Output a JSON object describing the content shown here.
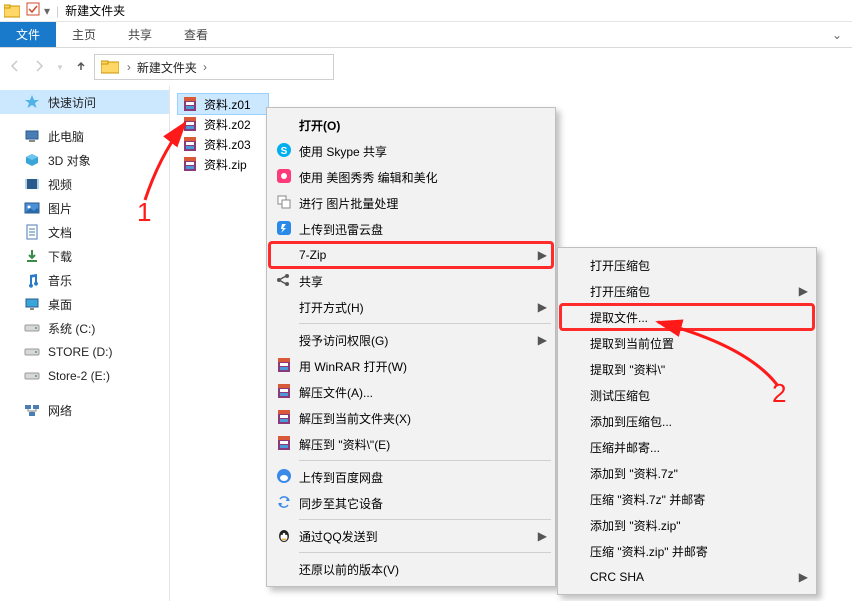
{
  "titlebar": {
    "title": "新建文件夹"
  },
  "ribbon": {
    "tabs": [
      "文件",
      "主页",
      "共享",
      "查看"
    ],
    "active_index": 0
  },
  "breadcrumb": {
    "items": [
      "",
      "新建文件夹"
    ]
  },
  "sidebar": {
    "items": [
      {
        "label": "快速访问",
        "icon": "star",
        "active": true
      },
      {
        "gap": true
      },
      {
        "label": "此电脑",
        "icon": "pc"
      },
      {
        "label": "3D 对象",
        "icon": "3d"
      },
      {
        "label": "视频",
        "icon": "video"
      },
      {
        "label": "图片",
        "icon": "pictures"
      },
      {
        "label": "文档",
        "icon": "docs"
      },
      {
        "label": "下载",
        "icon": "downloads"
      },
      {
        "label": "音乐",
        "icon": "music"
      },
      {
        "label": "桌面",
        "icon": "desktop"
      },
      {
        "label": "系统 (C:)",
        "icon": "drive"
      },
      {
        "label": "STORE (D:)",
        "icon": "drive"
      },
      {
        "label": "Store-2 (E:)",
        "icon": "drive"
      },
      {
        "gap": true
      },
      {
        "label": "网络",
        "icon": "network"
      }
    ]
  },
  "files": [
    {
      "name": "资料.z01",
      "icon": "rar",
      "selected": true
    },
    {
      "name": "资料.z02",
      "icon": "rar"
    },
    {
      "name": "资料.z03",
      "icon": "rar"
    },
    {
      "name": "资料.zip",
      "icon": "rar"
    }
  ],
  "context_menu": {
    "items": [
      {
        "label": "打开(O)",
        "bold": true
      },
      {
        "label": "使用 Skype 共享",
        "icon": "skype"
      },
      {
        "label": "使用 美图秀秀 编辑和美化",
        "icon": "meitu"
      },
      {
        "label": "进行 图片批量处理",
        "icon": "batch"
      },
      {
        "label": "上传到迅雷云盘",
        "icon": "xunlei"
      },
      {
        "label": "7-Zip",
        "submenu": true,
        "highlight": true
      },
      {
        "label": "共享",
        "icon": "share"
      },
      {
        "label": "打开方式(H)",
        "submenu": true
      },
      {
        "sep": true
      },
      {
        "label": "授予访问权限(G)",
        "submenu": true
      },
      {
        "label": "用 WinRAR 打开(W)",
        "icon": "rar"
      },
      {
        "label": "解压文件(A)...",
        "icon": "rar"
      },
      {
        "label": "解压到当前文件夹(X)",
        "icon": "rar"
      },
      {
        "label": "解压到 \"资料\\\"(E)",
        "icon": "rar"
      },
      {
        "sep": true
      },
      {
        "label": "上传到百度网盘",
        "icon": "baidu"
      },
      {
        "label": "同步至其它设备",
        "icon": "sync"
      },
      {
        "sep": true
      },
      {
        "label": "通过QQ发送到",
        "icon": "qq",
        "submenu": true
      },
      {
        "sep": true
      },
      {
        "label": "还原以前的版本(V)"
      }
    ]
  },
  "submenu": {
    "items": [
      {
        "label": "打开压缩包"
      },
      {
        "label": "打开压缩包",
        "submenu": true
      },
      {
        "label": "提取文件...",
        "highlight": true
      },
      {
        "label": "提取到当前位置"
      },
      {
        "label": "提取到 \"资料\\\""
      },
      {
        "label": "测试压缩包"
      },
      {
        "label": "添加到压缩包..."
      },
      {
        "label": "压缩并邮寄..."
      },
      {
        "label": "添加到 \"资料.7z\""
      },
      {
        "label": "压缩 \"资料.7z\" 并邮寄"
      },
      {
        "label": "添加到 \"资料.zip\""
      },
      {
        "label": "压缩 \"资料.zip\" 并邮寄"
      },
      {
        "label": "CRC SHA",
        "submenu": true
      }
    ]
  },
  "annotations": {
    "num1": "1",
    "num2": "2"
  }
}
